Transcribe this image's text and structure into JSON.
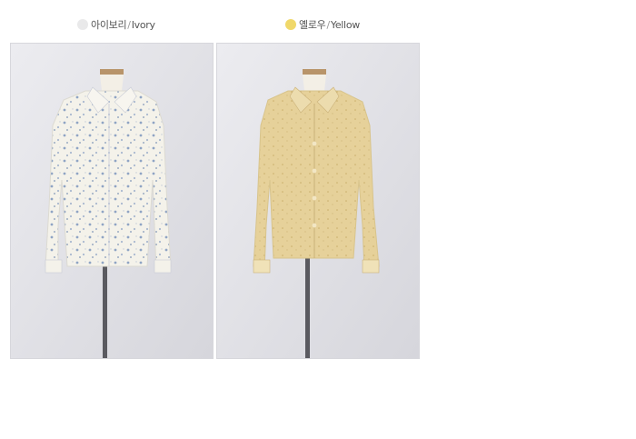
{
  "colors": [
    {
      "korean": "아이보리",
      "separator": "/",
      "english": "Ivory",
      "swatch_color": "#e9e9ea",
      "garment_color": "#f2f0e8",
      "print_color": "#8fa4c4"
    },
    {
      "korean": "옐로우",
      "separator": "/",
      "english": "Yellow",
      "swatch_color": "#f0d86a",
      "garment_color": "#e6d19a",
      "print_color": "#c9ae6a"
    }
  ]
}
